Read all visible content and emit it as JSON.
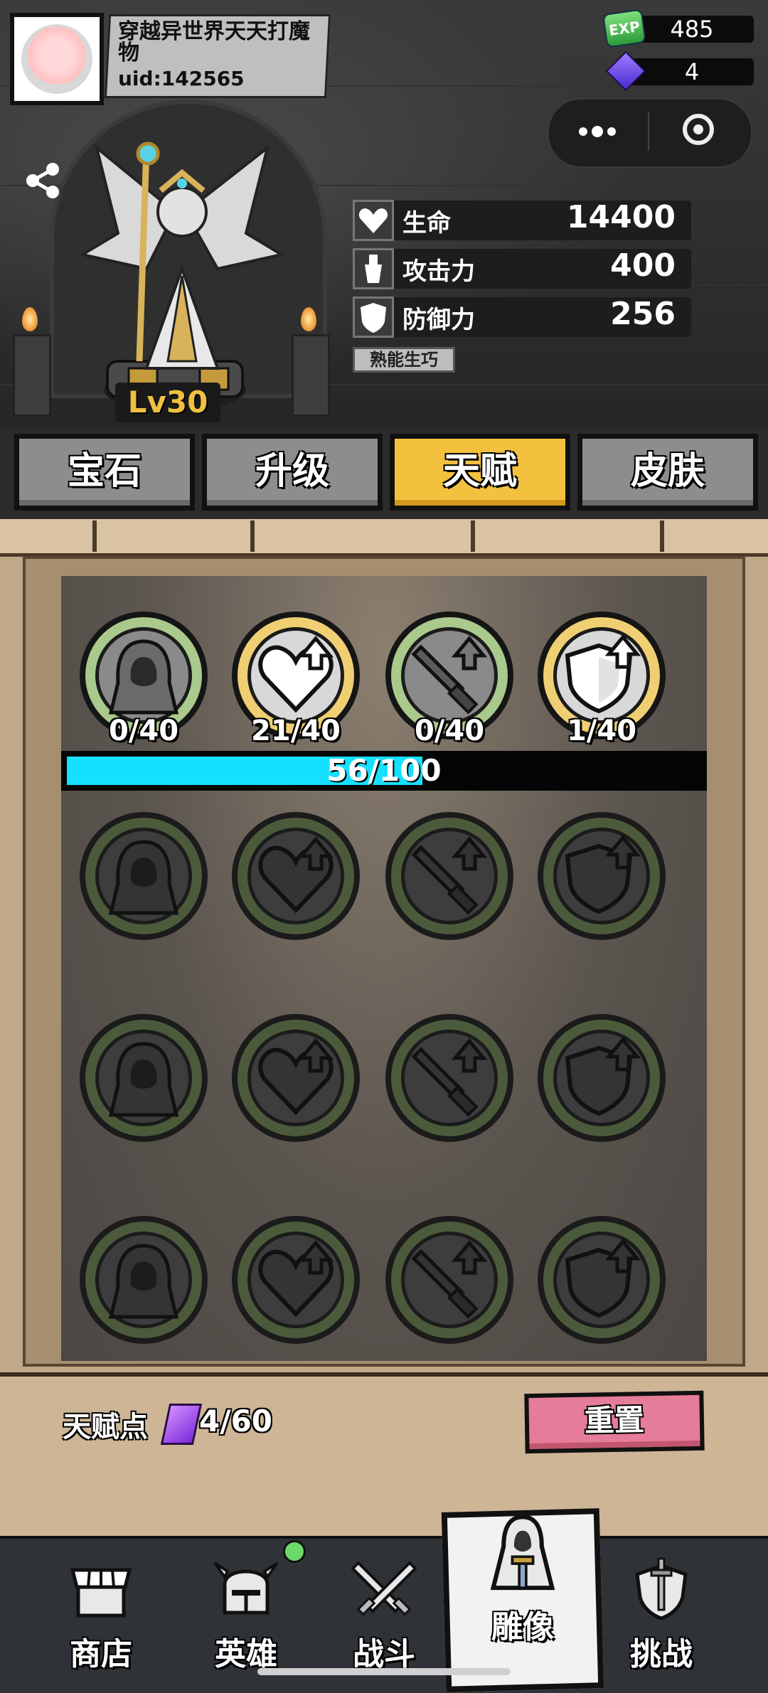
{
  "player": {
    "name": "穿越异世界天天打魔物",
    "uid": "uid:142565"
  },
  "resources": {
    "exp_icon_text": "EXP",
    "exp": "485",
    "gems": "4",
    "exp_color": "#3aa845",
    "gem_color": "#6f45e6"
  },
  "statue": {
    "level": "Lv30"
  },
  "stats": [
    {
      "label": "生命",
      "value": "14400",
      "icon": "heart-icon"
    },
    {
      "label": "攻击力",
      "value": "400",
      "icon": "potion-icon"
    },
    {
      "label": "防御力",
      "value": "256",
      "icon": "shield-icon"
    }
  ],
  "skill_tag": "熟能生巧",
  "tabs": [
    {
      "label": "宝石",
      "active": false
    },
    {
      "label": "升级",
      "active": false
    },
    {
      "label": "天赋",
      "active": true
    },
    {
      "label": "皮肤",
      "active": false
    }
  ],
  "talents": {
    "row1": [
      {
        "icon": "hooded-figure-icon",
        "count": "0/40",
        "ring": "green"
      },
      {
        "icon": "heart-up-icon",
        "count": "21/40",
        "ring": "yellow"
      },
      {
        "icon": "sword-up-icon",
        "count": "0/40",
        "ring": "green"
      },
      {
        "icon": "shield-up-icon",
        "count": "1/40",
        "ring": "yellow"
      }
    ],
    "progress_text": "56/100",
    "progress_fraction": 0.56,
    "progress_color": "#16e0ff",
    "locked_rows": 3
  },
  "footer": {
    "points_label": "天赋点",
    "points_value": "4/60",
    "reset_label": "重置",
    "reset_color": "#e57c9a"
  },
  "nav": [
    {
      "label": "商店",
      "icon": "shop-icon"
    },
    {
      "label": "英雄",
      "icon": "helmet-icon"
    },
    {
      "label": "战斗",
      "icon": "crossed-swords-icon"
    },
    {
      "label": "雕像",
      "icon": "statue-icon",
      "active": true
    },
    {
      "label": "挑战",
      "icon": "shield-sword-icon"
    }
  ],
  "accent_color": "#f4c13f"
}
